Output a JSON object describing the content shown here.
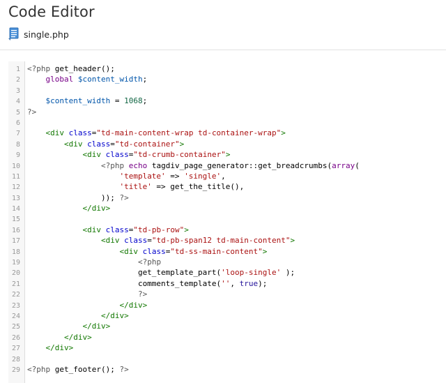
{
  "header": {
    "title": "Code Editor",
    "file_icon": "document-icon",
    "file_name": "single.php"
  },
  "colors": {
    "keyword": "#770088",
    "variable": "#0055aa",
    "number": "#116644",
    "string": "#aa1111",
    "tag": "#117700",
    "attribute": "#0000cc",
    "line_number": "#999999",
    "gutter_bg": "#f7f7f7"
  },
  "editor": {
    "lines": [
      {
        "n": "1",
        "tokens": [
          [
            "meta",
            "<?php"
          ],
          [
            "plain",
            " get_header();"
          ]
        ]
      },
      {
        "n": "2",
        "tokens": [
          [
            "plain",
            "    "
          ],
          [
            "kw",
            "global"
          ],
          [
            "plain",
            " "
          ],
          [
            "var",
            "$content_width"
          ],
          [
            "plain",
            ";"
          ]
        ]
      },
      {
        "n": "3",
        "tokens": []
      },
      {
        "n": "4",
        "tokens": [
          [
            "plain",
            "    "
          ],
          [
            "var",
            "$content_width"
          ],
          [
            "plain",
            " = "
          ],
          [
            "num",
            "1068"
          ],
          [
            "plain",
            ";"
          ]
        ]
      },
      {
        "n": "5",
        "tokens": [
          [
            "meta",
            "?>"
          ]
        ]
      },
      {
        "n": "6",
        "tokens": []
      },
      {
        "n": "7",
        "tokens": [
          [
            "plain",
            "    "
          ],
          [
            "tag",
            "<div"
          ],
          [
            "plain",
            " "
          ],
          [
            "attr",
            "class"
          ],
          [
            "plain",
            "="
          ],
          [
            "str",
            "\"td-main-content-wrap td-container-wrap\""
          ],
          [
            "tag",
            ">"
          ]
        ]
      },
      {
        "n": "8",
        "tokens": [
          [
            "plain",
            "        "
          ],
          [
            "tag",
            "<div"
          ],
          [
            "plain",
            " "
          ],
          [
            "attr",
            "class"
          ],
          [
            "plain",
            "="
          ],
          [
            "str",
            "\"td-container\""
          ],
          [
            "tag",
            ">"
          ]
        ]
      },
      {
        "n": "9",
        "tokens": [
          [
            "plain",
            "            "
          ],
          [
            "tag",
            "<div"
          ],
          [
            "plain",
            " "
          ],
          [
            "attr",
            "class"
          ],
          [
            "plain",
            "="
          ],
          [
            "str",
            "\"td-crumb-container\""
          ],
          [
            "tag",
            ">"
          ]
        ]
      },
      {
        "n": "10",
        "tokens": [
          [
            "plain",
            "                "
          ],
          [
            "meta",
            "<?php"
          ],
          [
            "plain",
            " "
          ],
          [
            "kw",
            "echo"
          ],
          [
            "plain",
            " tagdiv_page_generator::get_breadcrumbs("
          ],
          [
            "kw",
            "array"
          ],
          [
            "plain",
            "("
          ]
        ]
      },
      {
        "n": "11",
        "tokens": [
          [
            "plain",
            "                    "
          ],
          [
            "str",
            "'template'"
          ],
          [
            "plain",
            " => "
          ],
          [
            "str",
            "'single'"
          ],
          [
            "plain",
            ","
          ]
        ]
      },
      {
        "n": "12",
        "tokens": [
          [
            "plain",
            "                    "
          ],
          [
            "str",
            "'title'"
          ],
          [
            "plain",
            " => get_the_title(),"
          ]
        ]
      },
      {
        "n": "13",
        "tokens": [
          [
            "plain",
            "                )); "
          ],
          [
            "meta",
            "?>"
          ]
        ]
      },
      {
        "n": "14",
        "tokens": [
          [
            "plain",
            "            "
          ],
          [
            "tag",
            "</div>"
          ]
        ]
      },
      {
        "n": "15",
        "tokens": []
      },
      {
        "n": "16",
        "tokens": [
          [
            "plain",
            "            "
          ],
          [
            "tag",
            "<div"
          ],
          [
            "plain",
            " "
          ],
          [
            "attr",
            "class"
          ],
          [
            "plain",
            "="
          ],
          [
            "str",
            "\"td-pb-row\""
          ],
          [
            "tag",
            ">"
          ]
        ]
      },
      {
        "n": "17",
        "tokens": [
          [
            "plain",
            "                "
          ],
          [
            "tag",
            "<div"
          ],
          [
            "plain",
            " "
          ],
          [
            "attr",
            "class"
          ],
          [
            "plain",
            "="
          ],
          [
            "str",
            "\"td-pb-span12 td-main-content\""
          ],
          [
            "tag",
            ">"
          ]
        ]
      },
      {
        "n": "18",
        "tokens": [
          [
            "plain",
            "                    "
          ],
          [
            "tag",
            "<div"
          ],
          [
            "plain",
            " "
          ],
          [
            "attr",
            "class"
          ],
          [
            "plain",
            "="
          ],
          [
            "str",
            "\"td-ss-main-content\""
          ],
          [
            "tag",
            ">"
          ]
        ]
      },
      {
        "n": "19",
        "tokens": [
          [
            "plain",
            "                        "
          ],
          [
            "meta",
            "<?php"
          ]
        ]
      },
      {
        "n": "20",
        "tokens": [
          [
            "plain",
            "                        get_template_part("
          ],
          [
            "str",
            "'loop-single'"
          ],
          [
            "plain",
            " );"
          ]
        ]
      },
      {
        "n": "21",
        "tokens": [
          [
            "plain",
            "                        comments_template("
          ],
          [
            "str",
            "''"
          ],
          [
            "plain",
            ", "
          ],
          [
            "atom",
            "true"
          ],
          [
            "plain",
            ");"
          ]
        ]
      },
      {
        "n": "22",
        "tokens": [
          [
            "plain",
            "                        "
          ],
          [
            "meta",
            "?>"
          ]
        ]
      },
      {
        "n": "23",
        "tokens": [
          [
            "plain",
            "                    "
          ],
          [
            "tag",
            "</div>"
          ]
        ]
      },
      {
        "n": "24",
        "tokens": [
          [
            "plain",
            "                "
          ],
          [
            "tag",
            "</div>"
          ]
        ]
      },
      {
        "n": "25",
        "tokens": [
          [
            "plain",
            "            "
          ],
          [
            "tag",
            "</div>"
          ]
        ]
      },
      {
        "n": "26",
        "tokens": [
          [
            "plain",
            "        "
          ],
          [
            "tag",
            "</div>"
          ]
        ]
      },
      {
        "n": "27",
        "tokens": [
          [
            "plain",
            "    "
          ],
          [
            "tag",
            "</div>"
          ]
        ]
      },
      {
        "n": "28",
        "tokens": []
      },
      {
        "n": "29",
        "tokens": [
          [
            "meta",
            "<?php"
          ],
          [
            "plain",
            " get_footer(); "
          ],
          [
            "meta",
            "?>"
          ]
        ]
      }
    ]
  }
}
